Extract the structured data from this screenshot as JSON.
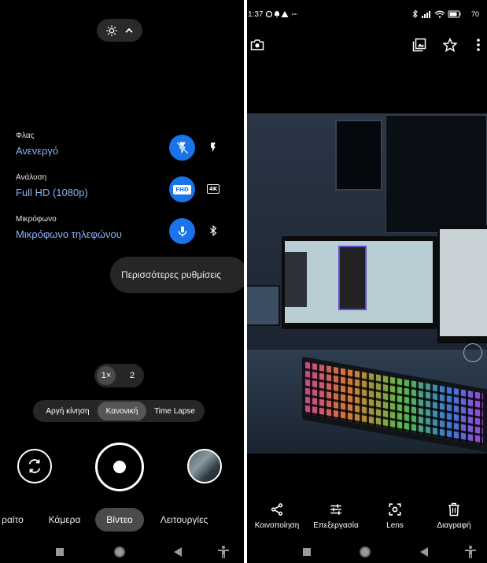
{
  "camera": {
    "settings_toggle": {
      "icon": "gear-icon",
      "chevron": "chevron-up-icon"
    },
    "settings": [
      {
        "label": "Φλας",
        "value": "Ανενεργό",
        "active_icon": "flash-off-icon",
        "other_icon": "flash-on-icon"
      },
      {
        "label": "Ανάλυση",
        "value": "Full HD (1080p)",
        "active_badge": "FHD",
        "other_badge": "4K"
      },
      {
        "label": "Μικρόφωνο",
        "value": "Μικρόφωνο τηλεφώνου",
        "active_icon": "microphone-icon",
        "other_icon": "bluetooth-icon"
      }
    ],
    "more_settings": "Περισσότερες ρυθμίσεις",
    "zoom": {
      "active": "1×",
      "other": "2"
    },
    "speed": {
      "slow": "Αργή κίνηση",
      "normal": "Κανονική",
      "timelapse": "Time Lapse",
      "selected": "Κανονική"
    },
    "modes": {
      "portrait": "ραίτο",
      "camera": "Κάμερα",
      "video": "Βίντεο",
      "features": "Λειτουργίες",
      "selected": "Βίντεο"
    }
  },
  "viewer": {
    "status": {
      "time": "1:37",
      "battery": "70"
    },
    "actions": [
      {
        "label": "Κοινοποίηση",
        "icon": "share-icon"
      },
      {
        "label": "Επεξεργασία",
        "icon": "edit-sliders-icon"
      },
      {
        "label": "Lens",
        "icon": "lens-icon"
      },
      {
        "label": "Διαγραφή",
        "icon": "trash-icon"
      }
    ]
  },
  "colors": {
    "accent": "#1a73e8",
    "value_text": "#8ab4f8",
    "pill_bg": "#262626"
  }
}
